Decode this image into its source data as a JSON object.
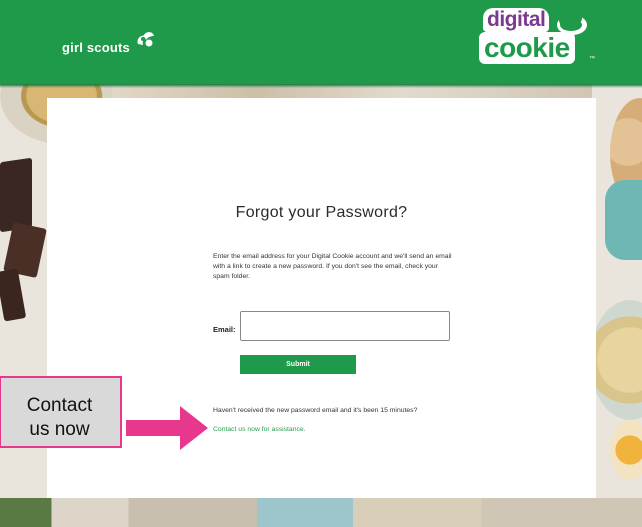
{
  "header": {
    "brand_left": "girl scouts",
    "brand_right_top": "digital",
    "brand_right_bottom": "cookie",
    "brand_tm": "™",
    "color": "#1f9a4a"
  },
  "form": {
    "title": "Forgot your Password?",
    "description": "Enter the email address for your Digital Cookie account and we'll send an email with a link to create a new password. If you don't see the email, check your spam folder.",
    "email_label": "Email:",
    "email_value": "",
    "submit_label": "Submit",
    "help_text": "Haven't received the new password email and it's been 15 minutes?",
    "help_link": "Contact us now for assistance."
  },
  "annotation": {
    "line1": "Contact",
    "line2": "us now",
    "border_color": "#e8388d",
    "arrow_color": "#e8388d"
  },
  "icons": [
    "trefoil-icon",
    "cookie-cloud-icon",
    "arrow-right-icon"
  ]
}
